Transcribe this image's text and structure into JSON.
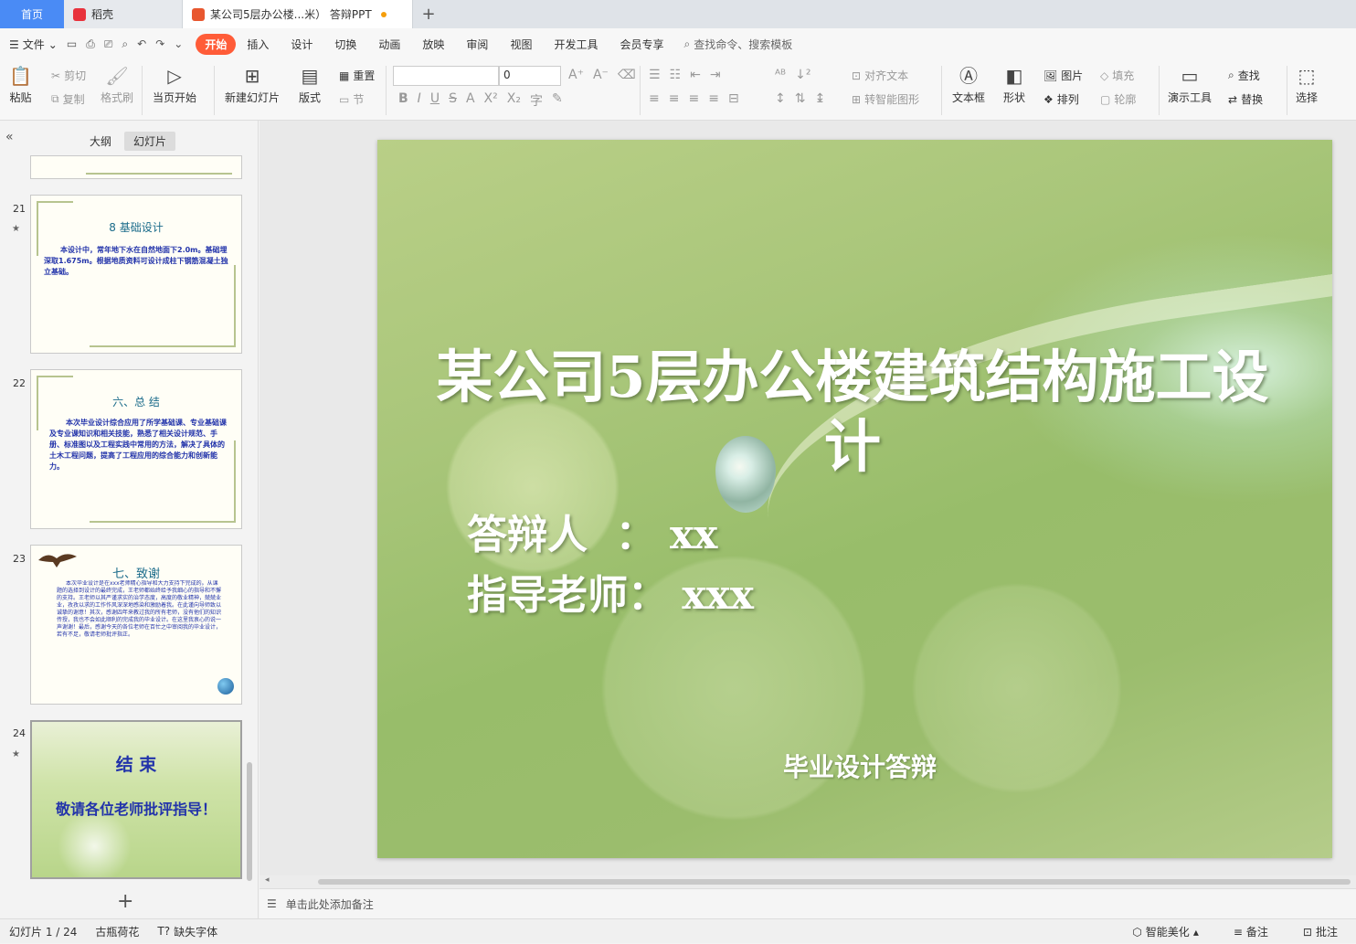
{
  "tabs": {
    "home": "首页",
    "doc1": "稻壳",
    "doc2": "某公司5层办公楼...米）  答辩PPT",
    "add": "+"
  },
  "menu": {
    "file": "文件",
    "items": [
      "开始",
      "插入",
      "设计",
      "切换",
      "动画",
      "放映",
      "审阅",
      "视图",
      "开发工具",
      "会员专享"
    ],
    "search": "查找命令、搜索模板"
  },
  "ribbon": {
    "paste": "粘贴",
    "cut": "剪切",
    "copy": "复制",
    "format_painter": "格式刷",
    "from_current": "当页开始",
    "new_slide": "新建幻灯片",
    "layout": "版式",
    "reset": "重置",
    "section": "节",
    "font_size": "0",
    "align_text": "对齐文本",
    "smart_shape": "转智能图形",
    "textbox": "文本框",
    "shape": "形状",
    "picture": "图片",
    "fill": "填充",
    "arrange": "排列",
    "outline": "轮廓",
    "presenter": "演示工具",
    "find": "查找",
    "replace": "替换",
    "select": "选择"
  },
  "panel": {
    "outline_tab": "大纲",
    "slides_tab": "幻灯片",
    "thumbs": [
      {
        "num": "21",
        "title": "8 基础设计",
        "body": "本设计中，常年地下水在自然地面下2.0m。基础埋深取1.675m。根据地质资料可设计成柱下钢筋混凝土独立基础。"
      },
      {
        "num": "22",
        "title": "六、总 结",
        "body": "本次毕业设计综合应用了所学基础课、专业基础课及专业课知识和相关技能，熟悉了相关设计规范、手册、标准图以及工程实践中常用的方法，解决了具体的土木工程问题，提高了工程应用的综合能力和创新能力。"
      },
      {
        "num": "23",
        "title": "七、致谢",
        "body": "本次毕业设计是在xxx老师精心指导和大力支持下完成的。从课题的选择到设计的最终完成，王老师都始终给予我细心的指导和不懈的支持。王老师以其严谨求实的治学态度，高度的敬业精神，兢兢业业，孜孜以求的工作作风深深地感染和激励着我。在此谨向导师致以诚挚的谢意！其次，感谢四年来教过我的所有老师，没有他们的知识传授，我也不会如此顺利的完成我的毕业设计。在这里我衷心的说一声谢谢！最后，感谢今天的各位老师在百忙之中审阅我的毕业设计，若有不足，敬请老师批评指正。"
      },
      {
        "num": "24",
        "title": "结  束",
        "body": "敬请各位老师批评指导！"
      }
    ],
    "add": "+"
  },
  "slide": {
    "title": "某公司5层办公楼建筑结构施工设计",
    "defender": "答辩人  ： xx",
    "advisor": "指导老师： xxx",
    "footer": "毕业设计答辩"
  },
  "notes": {
    "placeholder": "单击此处添加备注"
  },
  "status": {
    "slide_count": "幻灯片 1 / 24",
    "theme": "古瓶荷花",
    "missing_fonts": "缺失字体",
    "beautify": "智能美化",
    "notes": "备注",
    "comments": "批注"
  },
  "colors": {
    "accent": "#ff5c38",
    "home_tab": "#4a8bf5"
  }
}
